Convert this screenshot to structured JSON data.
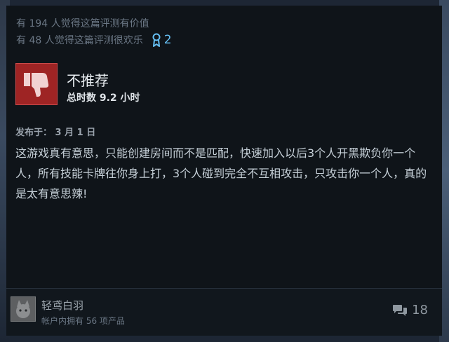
{
  "helpful": {
    "helpful_text": "有 194 人觉得这篇评测有价值",
    "funny_text": "有 48 人觉得这篇评测很欢乐",
    "award_count": "2",
    "award_icon": "award-ribbon-icon",
    "award_color": "#66c0f4"
  },
  "review": {
    "verdict": "不推荐",
    "verdict_icon": "thumbs-down-icon",
    "verdict_color": "#9e2424",
    "hours": "总时数 9.2 小时",
    "posted": "发布于： 3 月 1 日",
    "body": "这游戏真有意思，只能创建房间而不是匹配，快速加入以后3个人开黑欺负你一个人，所有技能卡牌往你身上打，3个人碰到完全不互相攻击，只攻击你一个人，真的是太有意思辣!"
  },
  "author": {
    "name": "轻鸢白羽",
    "owned": "帐户内拥有 56 项产品",
    "avatar_icon": "avatar-image"
  },
  "comments": {
    "count": "18",
    "icon": "comment-bubbles-icon"
  }
}
